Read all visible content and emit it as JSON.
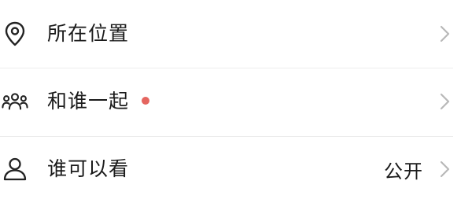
{
  "menu": {
    "items": [
      {
        "label": "所在位置",
        "icon": "location-pin-icon",
        "value": "",
        "has_badge": false
      },
      {
        "label": "和谁一起",
        "icon": "people-group-icon",
        "value": "",
        "has_badge": true
      },
      {
        "label": "谁可以看",
        "icon": "person-icon",
        "value": "公开",
        "has_badge": false
      }
    ]
  },
  "colors": {
    "text": "#1a1a1a",
    "icon": "#222222",
    "chevron": "#b8b8b8",
    "divider": "#ececec",
    "badge": "#e5655f"
  }
}
